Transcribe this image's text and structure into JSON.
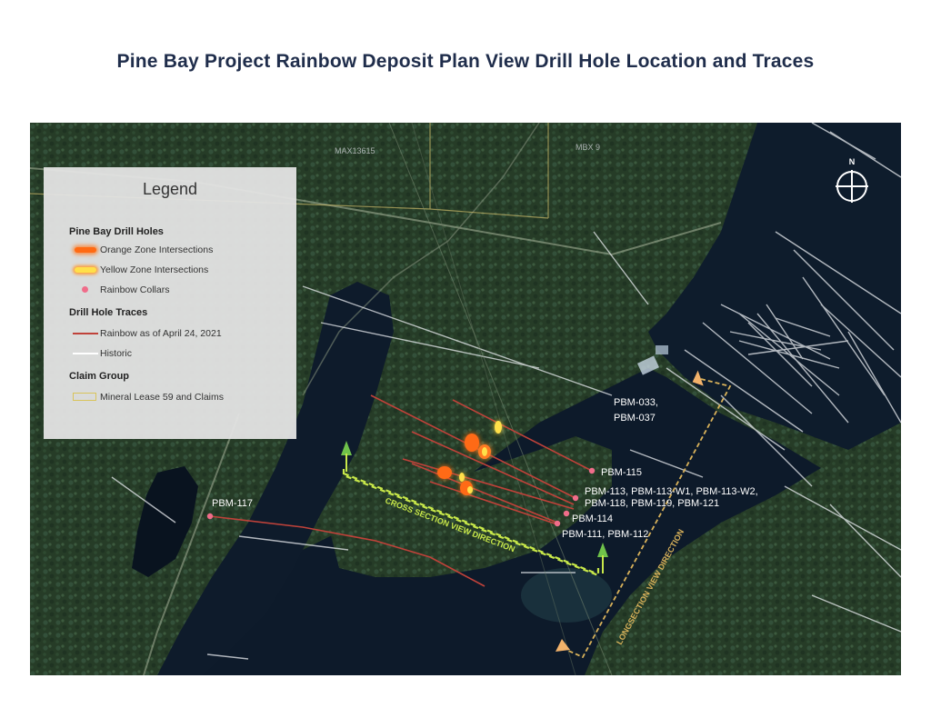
{
  "title": "Pine Bay Project Rainbow Deposit Plan View Drill Hole Location and Traces",
  "map": {
    "claim_labels": [
      "MAX13615",
      "MBX 9"
    ],
    "north_arrow_label": "N",
    "hole_labels": {
      "pbm_033": "PBM-033,",
      "pbm_037": "PBM-037",
      "pbm_115": "PBM-115",
      "pbm_113_line": "PBM-113, PBM-113-W1, PBM-113-W2,",
      "pbm_118_line": "PBM-118, PBM-119, PBM-121",
      "pbm_114": "PBM-114",
      "pbm_111_line": "PBM-111, PBM-112",
      "pbm_117": "PBM-117"
    },
    "cross_section_label": "CROSS SECTION VIEW DIRECTION",
    "longsection_label": "LONGSECTION VIEW DIRECTION"
  },
  "legend": {
    "title": "Legend",
    "groups": [
      {
        "heading": "Pine Bay Drill Holes",
        "items": [
          {
            "label": "Orange Zone Intersections",
            "symbol": "orange-zone"
          },
          {
            "label": "Yellow Zone Intersections",
            "symbol": "yellow-zone"
          },
          {
            "label": "Rainbow Collars",
            "symbol": "collar"
          }
        ]
      },
      {
        "heading": "Drill Hole Traces",
        "items": [
          {
            "label": "Rainbow as of April 24, 2021",
            "symbol": "trace-red"
          },
          {
            "label": "Historic",
            "symbol": "trace-white"
          }
        ]
      },
      {
        "heading": "Claim Group",
        "items": [
          {
            "label": "Mineral Lease 59 and Claims",
            "symbol": "claim-box"
          }
        ]
      }
    ]
  },
  "colors": {
    "title": "#1f2d4b",
    "forest": "#2a3f2b",
    "water": "#0f1e2e",
    "trace": "#c0423a",
    "collar": "#f06d8a",
    "section_line": "#c8e84a",
    "longsection_line": "#d9b25a",
    "arrow_green": "#6fc24a",
    "arrow_orange": "#f2b26a"
  }
}
